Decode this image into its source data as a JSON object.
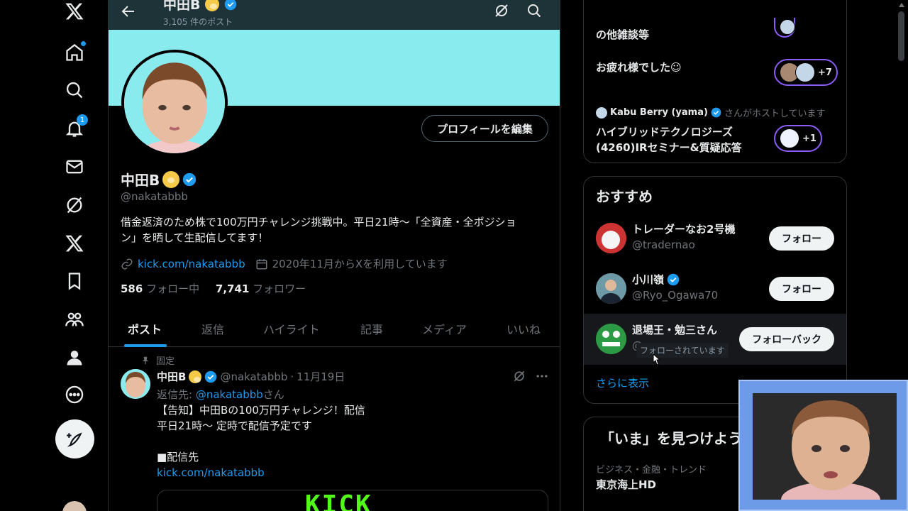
{
  "nav": {
    "notification_count": "1"
  },
  "header": {
    "name": "中田B",
    "post_count": "3,105 件のポスト"
  },
  "profile": {
    "name": "中田B",
    "handle": "@nakatabbb",
    "edit_button": "プロフィールを編集",
    "bio_line1": "借金返済のため株で100万円チャレンジ挑戦中。平日21時〜「全資産・全ポジショ",
    "bio_line2": "ン」を晒して生配信してます！",
    "link": "kick.com/nakatabbb",
    "joined": "2020年11月からXを利用しています",
    "following_count": "586",
    "following_label": "フォロー中",
    "followers_count": "7,741",
    "followers_label": "フォロワー"
  },
  "tabs": [
    {
      "label": "ポスト"
    },
    {
      "label": "返信"
    },
    {
      "label": "ハイライト"
    },
    {
      "label": "記事"
    },
    {
      "label": "メディア"
    },
    {
      "label": "いいね"
    }
  ],
  "post": {
    "pinned_label": "固定",
    "author": "中田B",
    "handle": "@nakatabbb",
    "date": "11月19日",
    "reply_prefix": "返信先: ",
    "reply_handle": "@nakatabbb",
    "reply_suffix": "さん",
    "lines": [
      "【告知】中田Bの100万円チャレンジ！配信",
      "平日21時〜 定時で配信予定です",
      "",
      "■配信先"
    ],
    "link": "kick.com/nakatabbb",
    "media_text": "KICK"
  },
  "search": {
    "placeholder": "検索"
  },
  "spaces": {
    "item1_title": "の他雑談等",
    "item2_title": "お疲れ様でした☺",
    "item2_count": "+7",
    "host_name": "Kabu Berry (yama)",
    "host_suffix": "さんがホストしています",
    "item3_title_line1": "ハイブリッドテクノロジーズ",
    "item3_title_line2": "(4260)IRセミナー&質疑応答",
    "item3_count": "+1"
  },
  "recommend": {
    "title": "おすすめ",
    "items": [
      {
        "name": "トレーダーなお2号機",
        "handle": "@tradernao",
        "button": "フォロー",
        "verified": false
      },
      {
        "name": "小川嶺",
        "handle": "@Ryo_Ogawa70",
        "button": "フォロー",
        "verified": true
      },
      {
        "name": "退場王・勉三さん",
        "handle": "@",
        "button": "フォローバック",
        "tooltip": "フォローされています",
        "verified": false
      }
    ],
    "show_more": "さらに表示"
  },
  "trends": {
    "title": "「いま」を見つけよう",
    "category": "ビジネス・金融・トレンド",
    "name": "東京海上HD"
  },
  "colors": {
    "accent": "#1d9bf0",
    "banner": "#8aebee",
    "space_purple": "#8c5cf6",
    "kick_green": "#53fc18"
  }
}
